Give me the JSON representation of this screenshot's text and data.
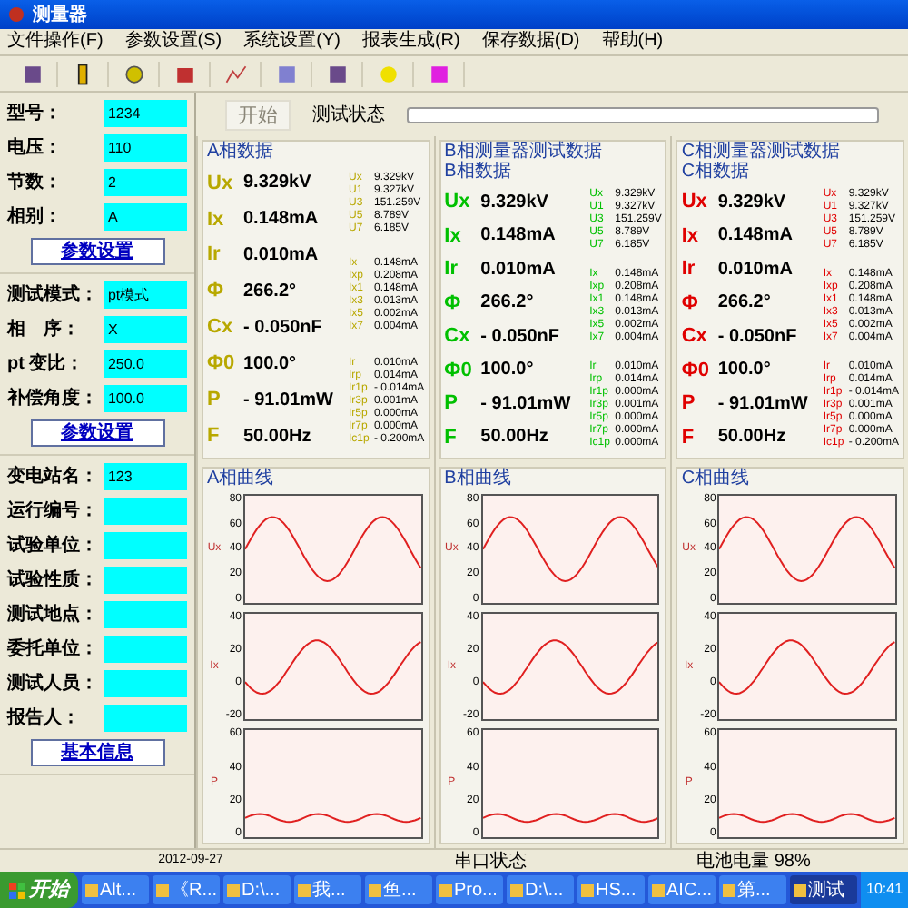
{
  "window": {
    "title": "测量器"
  },
  "menu": [
    "文件操作(F)",
    "参数设置(S)",
    "系统设置(Y)",
    "报表生成(R)",
    "保存数据(D)",
    "帮助(H)"
  ],
  "left_panel": [
    {
      "fields": [
        {
          "label": "型号：",
          "value": "1234"
        },
        {
          "label": "电压：",
          "value": "110"
        },
        {
          "label": "节数：",
          "value": "2"
        },
        {
          "label": "相别：",
          "value": "A"
        }
      ],
      "button": "参数设置"
    },
    {
      "fields": [
        {
          "label": "测试模式：",
          "value": "pt模式"
        },
        {
          "label": "相　序：",
          "value": "X"
        },
        {
          "label": "pt 变比：",
          "value": "250.0"
        },
        {
          "label": "补偿角度：",
          "value": "100.0"
        }
      ],
      "button": "参数设置"
    },
    {
      "fields": [
        {
          "label": "变电站名：",
          "value": "123"
        },
        {
          "label": "运行编号："
        },
        {
          "label": "试验单位："
        },
        {
          "label": "试验性质："
        },
        {
          "label": "测试地点："
        },
        {
          "label": "委托单位："
        },
        {
          "label": "测试人员："
        },
        {
          "label": "报告人："
        }
      ],
      "button": "基本信息"
    }
  ],
  "control": {
    "start_button": {
      "label": "开始",
      "disabled": true
    },
    "status_label": "测试状态",
    "progress": {
      "level": 0
    }
  },
  "phases": [
    {
      "color": "#b8a800",
      "title": "A相数据",
      "main": [
        {
          "label": "Ux",
          "value": "9.329kV"
        },
        {
          "label": "Ix",
          "value": "0.148mA"
        },
        {
          "label": "Ir",
          "value": "0.010mA"
        },
        {
          "label": "Φ",
          "value": "266.2°"
        },
        {
          "label": "Cx",
          "value": "- 0.050nF"
        },
        {
          "label": "Φ0",
          "value": "100.0°"
        },
        {
          "label": "P",
          "value": "- 91.01mW"
        },
        {
          "label": "F",
          "value": "50.00Hz"
        }
      ],
      "harmonics": [
        [
          {
            "label": "Ux",
            "value": "9.329kV"
          },
          {
            "label": "U1",
            "value": "9.327kV"
          },
          {
            "label": "U3",
            "value": "151.259V"
          },
          {
            "label": "U5",
            "value": "8.789V"
          },
          {
            "label": "U7",
            "value": "6.185V"
          }
        ],
        [
          {
            "label": "Ix",
            "value": "0.148mA"
          },
          {
            "label": "Ixp",
            "value": "0.208mA"
          },
          {
            "label": "Ix1",
            "value": "0.148mA"
          },
          {
            "label": "Ix3",
            "value": "0.013mA"
          },
          {
            "label": "Ix5",
            "value": "0.002mA"
          },
          {
            "label": "Ix7",
            "value": "0.004mA"
          }
        ],
        [
          {
            "label": "Ir",
            "value": "0.010mA"
          },
          {
            "label": "Irp",
            "value": "0.014mA"
          },
          {
            "label": "Ir1p",
            "value": "- 0.014mA"
          },
          {
            "label": "Ir3p",
            "value": "0.001mA"
          },
          {
            "label": "Ir5p",
            "value": "0.000mA"
          },
          {
            "label": "Ir7p",
            "value": "0.000mA"
          },
          {
            "label": "Ic1p",
            "value": "- 0.200mA"
          }
        ]
      ],
      "curve_title": "A相曲线",
      "plots": [
        {
          "label": "Ux",
          "ticks": [
            "80",
            "60",
            "40",
            "20",
            "0"
          ]
        },
        {
          "label": "Ix",
          "ticks": [
            "40",
            "20",
            "0",
            "-20"
          ]
        },
        {
          "label": "P",
          "ticks": [
            "60",
            "40",
            "20",
            "0"
          ]
        }
      ]
    },
    {
      "color": "#00c000",
      "group_title": "B相测量器测试数据",
      "title": "B相数据",
      "main": [
        {
          "label": "Ux",
          "value": "9.329kV"
        },
        {
          "label": "Ix",
          "value": "0.148mA"
        },
        {
          "label": "Ir",
          "value": "0.010mA"
        },
        {
          "label": "Φ",
          "value": "266.2°"
        },
        {
          "label": "Cx",
          "value": "- 0.050nF"
        },
        {
          "label": "Φ0",
          "value": "100.0°"
        },
        {
          "label": "P",
          "value": "- 91.01mW"
        },
        {
          "label": "F",
          "value": "50.00Hz"
        }
      ],
      "harmonics": [
        [
          {
            "label": "Ux",
            "value": "9.329kV"
          },
          {
            "label": "U1",
            "value": "9.327kV"
          },
          {
            "label": "U3",
            "value": "151.259V"
          },
          {
            "label": "U5",
            "value": "8.789V"
          },
          {
            "label": "U7",
            "value": "6.185V"
          }
        ],
        [
          {
            "label": "Ix",
            "value": "0.148mA"
          },
          {
            "label": "Ixp",
            "value": "0.208mA"
          },
          {
            "label": "Ix1",
            "value": "0.148mA"
          },
          {
            "label": "Ix3",
            "value": "0.013mA"
          },
          {
            "label": "Ix5",
            "value": "0.002mA"
          },
          {
            "label": "Ix7",
            "value": "0.004mA"
          }
        ],
        [
          {
            "label": "Ir",
            "value": "0.010mA"
          },
          {
            "label": "Irp",
            "value": "0.014mA"
          },
          {
            "label": "Ir1p",
            "value": "0.000mA"
          },
          {
            "label": "Ir3p",
            "value": "0.001mA"
          },
          {
            "label": "Ir5p",
            "value": "0.000mA"
          },
          {
            "label": "Ir7p",
            "value": "0.000mA"
          },
          {
            "label": "Ic1p",
            "value": "0.000mA"
          }
        ]
      ],
      "curve_title": "B相曲线",
      "plots": [
        {
          "label": "Ux",
          "ticks": [
            "80",
            "60",
            "40",
            "20",
            "0"
          ]
        },
        {
          "label": "Ix",
          "ticks": [
            "40",
            "20",
            "0",
            "-20"
          ]
        },
        {
          "label": "P",
          "ticks": [
            "60",
            "40",
            "20",
            "0"
          ]
        }
      ]
    },
    {
      "color": "#e00000",
      "group_title": "C相测量器测试数据",
      "title": "C相数据",
      "main": [
        {
          "label": "Ux",
          "value": "9.329kV"
        },
        {
          "label": "Ix",
          "value": "0.148mA"
        },
        {
          "label": "Ir",
          "value": "0.010mA"
        },
        {
          "label": "Φ",
          "value": "266.2°"
        },
        {
          "label": "Cx",
          "value": "- 0.050nF"
        },
        {
          "label": "Φ0",
          "value": "100.0°"
        },
        {
          "label": "P",
          "value": "- 91.01mW"
        },
        {
          "label": "F",
          "value": "50.00Hz"
        }
      ],
      "harmonics": [
        [
          {
            "label": "Ux",
            "value": "9.329kV"
          },
          {
            "label": "U1",
            "value": "9.327kV"
          },
          {
            "label": "U3",
            "value": "151.259V"
          },
          {
            "label": "U5",
            "value": "8.789V"
          },
          {
            "label": "U7",
            "value": "6.185V"
          }
        ],
        [
          {
            "label": "Ix",
            "value": "0.148mA"
          },
          {
            "label": "Ixp",
            "value": "0.208mA"
          },
          {
            "label": "Ix1",
            "value": "0.148mA"
          },
          {
            "label": "Ix3",
            "value": "0.013mA"
          },
          {
            "label": "Ix5",
            "value": "0.002mA"
          },
          {
            "label": "Ix7",
            "value": "0.004mA"
          }
        ],
        [
          {
            "label": "Ir",
            "value": "0.010mA"
          },
          {
            "label": "Irp",
            "value": "0.014mA"
          },
          {
            "label": "Ir1p",
            "value": "- 0.014mA"
          },
          {
            "label": "Ir3p",
            "value": "0.001mA"
          },
          {
            "label": "Ir5p",
            "value": "0.000mA"
          },
          {
            "label": "Ir7p",
            "value": "0.000mA"
          },
          {
            "label": "Ic1p",
            "value": "- 0.200mA"
          }
        ]
      ],
      "curve_title": "C相曲线",
      "plots": [
        {
          "label": "Ux",
          "ticks": [
            "80",
            "60",
            "40",
            "20",
            "0"
          ]
        },
        {
          "label": "Ix",
          "ticks": [
            "40",
            "20",
            "0",
            "-20"
          ]
        },
        {
          "label": "P",
          "ticks": [
            "60",
            "40",
            "20",
            "0"
          ]
        }
      ]
    }
  ],
  "status_bar": [
    "2012-09-27",
    "串口状态",
    "电池电量 98%"
  ],
  "taskbar": {
    "start": "开始",
    "items": [
      {
        "label": "Alt...",
        "selected": false
      },
      {
        "label": "《R...",
        "selected": false
      },
      {
        "label": "D:\\...",
        "selected": false
      },
      {
        "label": "我...",
        "selected": false
      },
      {
        "label": "鱼...",
        "selected": false
      },
      {
        "label": "Pro...",
        "selected": false
      },
      {
        "label": "D:\\...",
        "selected": false
      },
      {
        "label": "HS...",
        "selected": false
      },
      {
        "label": "AIC...",
        "selected": false
      },
      {
        "label": "第...",
        "selected": false
      },
      {
        "label": "测试",
        "selected": true
      }
    ],
    "clock": "10:41"
  }
}
